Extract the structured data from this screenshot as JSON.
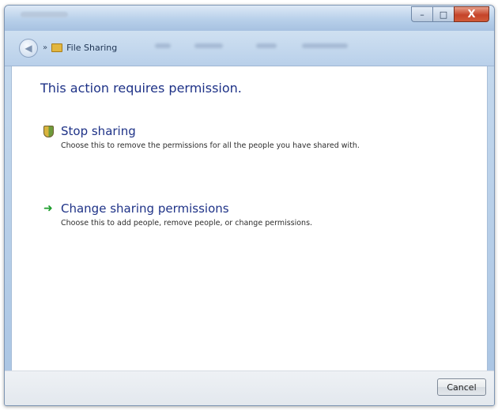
{
  "window": {
    "title_icon": "folder-icon",
    "caption_min_glyph": "–",
    "caption_max_glyph": "□",
    "caption_close_glyph": "X",
    "back_glyph": "◀"
  },
  "address_bar": {
    "breadcrumb": "File Sharing",
    "chevron": "»"
  },
  "main": {
    "heading": "This action requires permission.",
    "options": [
      {
        "title": "Stop sharing",
        "description": "Choose this to remove the permissions for all the people you have shared with.",
        "icon": "shield-icon"
      },
      {
        "title": "Change sharing permissions",
        "description": "Choose this to add people, remove people, or change permissions.",
        "icon": "green-arrow-icon",
        "icon_glyph": "➜"
      }
    ]
  },
  "footer": {
    "cancel_label": "Cancel"
  },
  "colors": {
    "link_text": "#1e3287",
    "heading_text": "#1e3287",
    "arrow_green": "#1c9d2c"
  }
}
